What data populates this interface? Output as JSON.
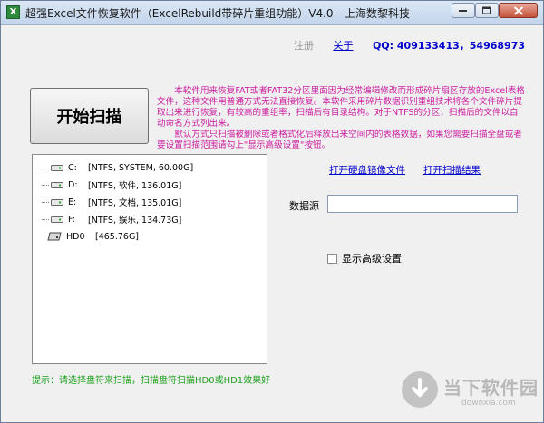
{
  "window": {
    "title": "超强Excel文件恢复软件（ExcelRebuild带碎片重组功能）V4.0 --上海数黎科技--",
    "app_icon_text": "X"
  },
  "header": {
    "register_label": "注册",
    "about_label": "关于",
    "qq_text": "QQ: 409133413，54968973"
  },
  "start_button": {
    "label": "开始扫描"
  },
  "description": {
    "paragraph1": "本软件用来恢复FAT或者FAT32分区里面因为经常编辑修改而形成碎片扇区存放的Excel表格文件，这种文件用普通方式无法直接恢复。本软件采用碎片数据识别重组技术将各个文件碎片提取出来进行恢复，有较高的重组率，扫描后有目录结构。对于NTFS的分区，扫描后的文件以自动命名方式列出来。",
    "paragraph2": "默认方式只扫描被删除或者格式化后释放出来空间内的表格数据，如果您需要扫描全盘或者要设置扫描范围请勾上\"显示高级设置\"按钮。"
  },
  "drives": [
    {
      "letter": "C:",
      "info": "[NTFS, SYSTEM, 60.00G]",
      "icon": "drive-icon"
    },
    {
      "letter": "D:",
      "info": "[NTFS, 软件, 136.01G]",
      "icon": "drive-icon"
    },
    {
      "letter": "E:",
      "info": "[NTFS, 文档, 135.01G]",
      "icon": "drive-icon"
    },
    {
      "letter": "F:",
      "info": "[NTFS, 娱乐, 134.73G]",
      "icon": "drive-icon"
    },
    {
      "letter": "HD0",
      "info": "[465.76G]",
      "icon": "hard-disk-icon"
    }
  ],
  "links": {
    "open_disk_image": "打开硬盘镜像文件",
    "open_scan_result": "打开扫描结果"
  },
  "data_source": {
    "label": "数据源",
    "value": ""
  },
  "advanced": {
    "label": "显示高级设置",
    "checked": false
  },
  "hint": "提示：请选择盘符来扫描，扫描盘符扫描HD0或HD1效果好",
  "watermark": {
    "title": "当下软件园",
    "url": "downxia.com"
  }
}
